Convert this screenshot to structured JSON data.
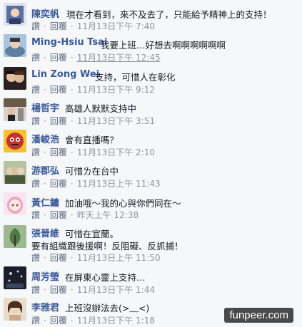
{
  "comments": [
    {
      "name": "陳奕帆",
      "text": "現在才看到，來不及去了，只能給予精神上的支持！",
      "text_line2": "",
      "like": "讚",
      "reply": "回覆",
      "time": "11月13日下午 7:40",
      "avatar_color": "#5a6fa6"
    },
    {
      "name": "Ming-Hsiu Tsai",
      "text": "我要上班…好想去啊啊啊啊啊啊",
      "text_line2": "",
      "like": "讚",
      "reply": "回覆",
      "time": "11月13日下午 12:45",
      "avatar_color": "#7aa0c8"
    },
    {
      "name": "Lin Zong Wei",
      "text": "支持，可惜人在彰化",
      "text_line2": "",
      "like": "讚",
      "reply": "回覆",
      "time": "11月13日下午 9:12",
      "avatar_color": "#6b4e3d"
    },
    {
      "name": "楊哲宇",
      "text": "高雄人默默支持中",
      "text_line2": "",
      "like": "讚",
      "reply": "回覆",
      "time": "11月13日下午 3:51",
      "avatar_color": "#8a6a4e"
    },
    {
      "name": "潘峻浩",
      "text": "會有直播嗎？",
      "text_line2": "",
      "like": "讚",
      "reply": "回覆",
      "time": "11月13日下午 2:10",
      "avatar_color": "#c8322b"
    },
    {
      "name": "游郡弘",
      "text": "可惜ㄌ在台中",
      "text_line2": "",
      "like": "讚",
      "reply": "回覆",
      "time": "11月13日上午 11:43",
      "avatar_color": "#8fa070"
    },
    {
      "name": "黃仁鏞",
      "text": "加油哦～我的心與你們同在～",
      "text_line2": "",
      "like": "讚",
      "reply": "回覆",
      "time": "昨天上午 12:38",
      "avatar_color": "#e8a7c0"
    },
    {
      "name": "張晉維",
      "text": "可惜在宜蘭。",
      "text_line2": "要有組織跟後援啊！反阻礙、反抓捕！",
      "like": "讚",
      "reply": "回覆",
      "time": "11月13日上午 11:50",
      "avatar_color": "#5d8a58"
    },
    {
      "name": "周芳瑩",
      "text": "在屏東心靈上支持…",
      "text_line2": "",
      "like": "讚",
      "reply": "回覆",
      "time": "11月13日下午 1:44",
      "avatar_color": "#3a4560"
    },
    {
      "name": "李雅君",
      "text": "上班沒辦法去(>﹏<)",
      "text_line2": "",
      "like": "讚",
      "reply": "回覆",
      "time": "11月13日下午 1:18",
      "avatar_color": "#c9a98a"
    }
  ],
  "watermark": "funpeer.com"
}
